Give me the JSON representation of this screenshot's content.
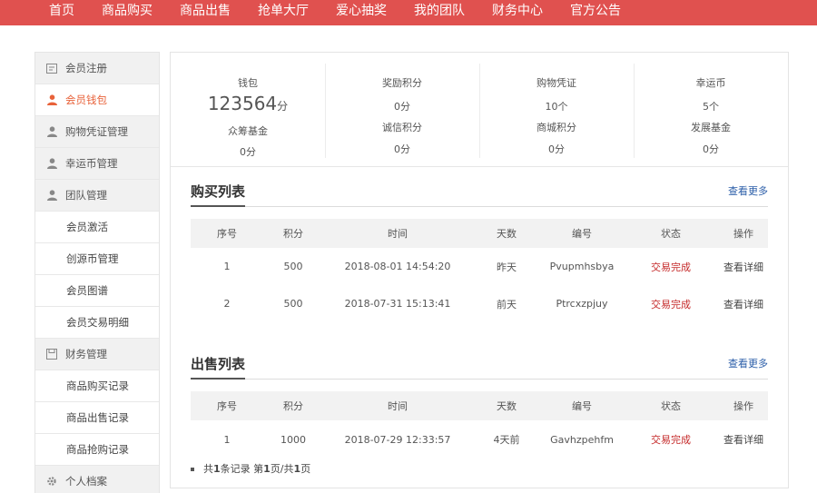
{
  "nav": [
    "首页",
    "商品购买",
    "商品出售",
    "抢单大厅",
    "爱心抽奖",
    "我的团队",
    "财务中心",
    "官方公告"
  ],
  "sidebar": [
    {
      "label": "会员注册",
      "type": "group",
      "icon": "register-icon"
    },
    {
      "label": "会员钱包",
      "type": "active",
      "icon": "user-icon"
    },
    {
      "label": "购物凭证管理",
      "type": "group",
      "icon": "user-icon"
    },
    {
      "label": "幸运币管理",
      "type": "group",
      "icon": "user-icon"
    },
    {
      "label": "团队管理",
      "type": "group",
      "icon": "user-icon"
    },
    {
      "label": "会员激活",
      "type": "sub"
    },
    {
      "label": "创源币管理",
      "type": "sub"
    },
    {
      "label": "会员图谱",
      "type": "sub"
    },
    {
      "label": "会员交易明细",
      "type": "sub"
    },
    {
      "label": "财务管理",
      "type": "group",
      "icon": "finance-icon"
    },
    {
      "label": "商品购买记录",
      "type": "sub"
    },
    {
      "label": "商品出售记录",
      "type": "sub"
    },
    {
      "label": "商品抢购记录",
      "type": "sub"
    },
    {
      "label": "个人档案",
      "type": "group",
      "icon": "gear-icon"
    }
  ],
  "stats": {
    "wallet_label": "钱包",
    "wallet_value": "123564",
    "wallet_unit": "分",
    "fund_label": "众筹基金",
    "fund_value": "0分",
    "reward_label": "奖励积分",
    "reward_value": "0分",
    "integrity_label": "诚信积分",
    "integrity_value": "0分",
    "voucher_label": "购物凭证",
    "voucher_value": "10个",
    "mall_label": "商城积分",
    "mall_value": "0分",
    "lucky_label": "幸运币",
    "lucky_value": "5个",
    "dev_label": "发展基金",
    "dev_value": "0分"
  },
  "purchase": {
    "title": "购买列表",
    "more": "查看更多",
    "headers": [
      "序号",
      "积分",
      "时间",
      "天数",
      "编号",
      "状态",
      "操作"
    ],
    "rows": [
      [
        "1",
        "500",
        "2018-08-01 14:54:20",
        "昨天",
        "Pvupmhsbya",
        "交易完成",
        "查看详细"
      ],
      [
        "2",
        "500",
        "2018-07-31 15:13:41",
        "前天",
        "Ptrcxzpjuy",
        "交易完成",
        "查看详细"
      ]
    ]
  },
  "sale": {
    "title": "出售列表",
    "more": "查看更多",
    "headers": [
      "序号",
      "积分",
      "时间",
      "天数",
      "编号",
      "状态",
      "操作"
    ],
    "rows": [
      [
        "1",
        "1000",
        "2018-07-29 12:33:57",
        "4天前",
        "Gavhzpehfm",
        "交易完成",
        "查看详细"
      ]
    ],
    "pager": {
      "prefix": "共",
      "count": "1",
      "mid": "条记录 第",
      "page": "1",
      "sep": "页/共",
      "total": "1",
      "suffix": "页"
    }
  },
  "colors": {
    "nav_bg": "#e0514f",
    "active": "#e8623a",
    "status": "#c52a2a",
    "link": "#2a5da8"
  }
}
